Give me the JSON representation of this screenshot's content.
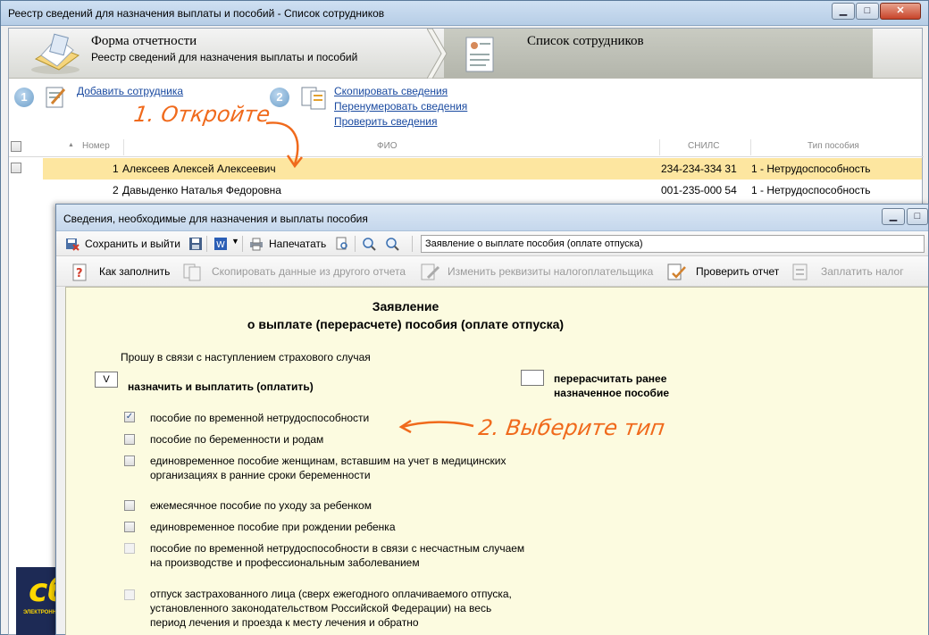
{
  "window": {
    "title": "Реестр сведений для назначения выплаты и пособий - Список сотрудников",
    "controls": {
      "minimize": "▁",
      "maximize": "□",
      "close": "✕"
    }
  },
  "wizard": {
    "left_title": "Форма отчетности",
    "left_subtitle": "Реестр сведений для назначения выплаты и пособий",
    "right_title": "Список сотрудников"
  },
  "actions": {
    "step1": "1",
    "step2": "2",
    "add_employee": "Добавить сотрудника",
    "copy_info": "Скопировать сведения",
    "renumber_info": "Перенумеровать сведения",
    "check_info": "Проверить сведения"
  },
  "grid": {
    "headers": {
      "number": "Номер",
      "fio": "ФИО",
      "snils": "СНИЛС",
      "type": "Тип пособия"
    },
    "rows": [
      {
        "num": "1",
        "fio": "Алексеев Алексей Алексеевич",
        "snils": "234-234-334 31",
        "type": "1 - Нетрудоспособность"
      },
      {
        "num": "2",
        "fio": "Давыденко Наталья Федоровна",
        "snils": "001-235-000 54",
        "type": "1 - Нетрудоспособность"
      }
    ]
  },
  "logo": {
    "text": "сб",
    "subtext": "ЭЛЕКТРОНН"
  },
  "dialog": {
    "title": "Сведения, необходимые для назначения и выплаты пособия",
    "toolbar1": {
      "save_exit": "Сохранить и выйти",
      "print": "Напечатать",
      "form_select": "Заявление о выплате пособия (оплате отпуска)"
    },
    "toolbar2": {
      "how_fill": "Как заполнить",
      "copy_other": "Скопировать данные из другого отчета",
      "change_details": "Изменить реквизиты налогоплательщика",
      "check_report": "Проверить отчет",
      "pay_tax": "Заплатить налог"
    },
    "form": {
      "title1": "Заявление",
      "title2": "о выплате (перерасчете) пособия (оплате отпуска)",
      "intro": "Прошу в связи с наступлением страхового случая",
      "assign_mark": "V",
      "assign_label": "назначить и выплатить (оплатить)",
      "recalc_label1": "перерасчитать ранее",
      "recalc_label2": "назначенное пособие",
      "options": [
        {
          "label": "пособие по временной нетрудоспособности",
          "checked": true
        },
        {
          "label": "пособие по беременности и родам",
          "checked": false
        },
        {
          "label": "единовременное пособие женщинам, вставшим на учет в медицинских",
          "label2": "организациях в ранние сроки беременности",
          "checked": false
        },
        {
          "label": "ежемесячное пособие по уходу за ребенком",
          "checked": false
        },
        {
          "label": "единовременное пособие при рождении ребенка",
          "checked": false
        },
        {
          "label": "пособие по временной нетрудоспособности в связи с несчастным случаем",
          "label2": "на производстве и профессиональным заболеванием",
          "checked": false
        },
        {
          "label": "отпуск застрахованного лица (сверх ежегодного оплачиваемого отпуска,",
          "label2": "установленного законодательством Российской Федерации) на весь",
          "label3": "период лечения и проезда к месту лечения и обратно",
          "checked": false
        }
      ],
      "check_mark": "✓"
    }
  },
  "annotations": {
    "open": "1. Откройте",
    "choose": "2. Выберите тип"
  },
  "colors": {
    "annotation": "#f06a1c",
    "selected_row": "#fde6a0",
    "form_bg": "#fcfbe0",
    "link": "#1a4aa0"
  }
}
